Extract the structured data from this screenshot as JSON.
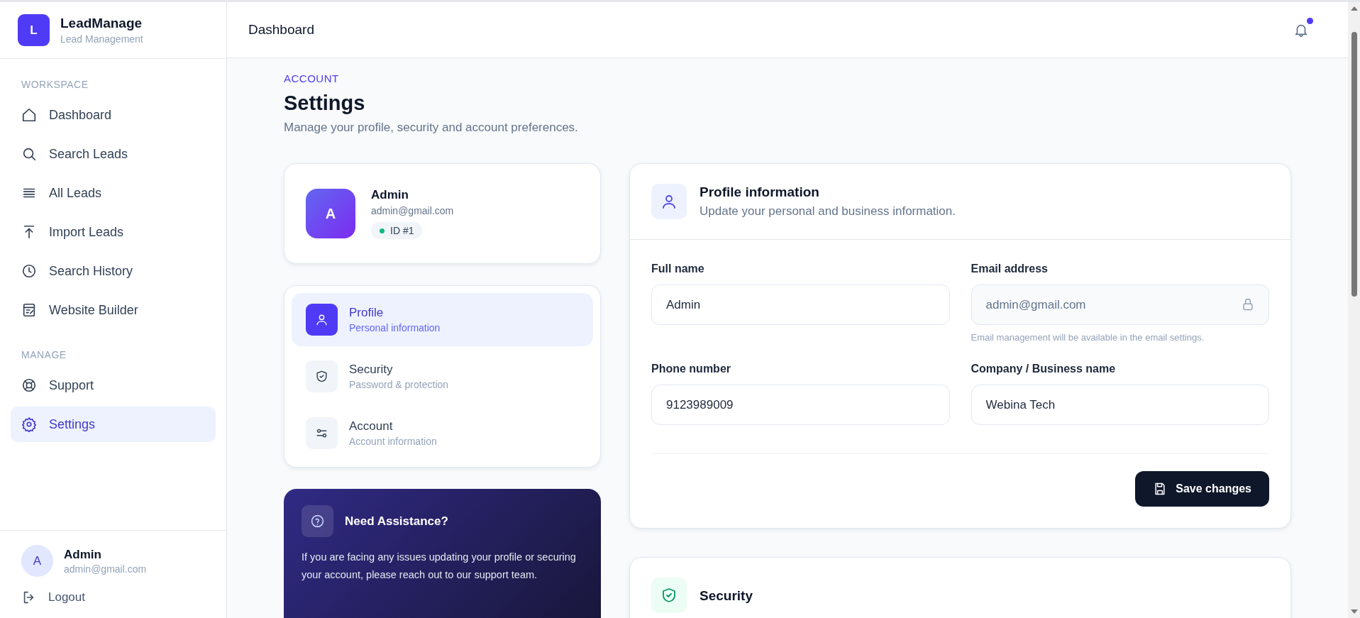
{
  "brand": {
    "logo_letter": "L",
    "name": "LeadManage",
    "tagline": "Lead Management"
  },
  "sidebar": {
    "sections": [
      {
        "title": "WORKSPACE",
        "items": [
          {
            "label": "Dashboard",
            "selected": false
          },
          {
            "label": "Search Leads",
            "selected": false
          },
          {
            "label": "All Leads",
            "selected": false
          },
          {
            "label": "Import Leads",
            "selected": false
          },
          {
            "label": "Search History",
            "selected": false
          },
          {
            "label": "Website Builder",
            "selected": false
          }
        ]
      },
      {
        "title": "MANAGE",
        "items": [
          {
            "label": "Support",
            "selected": false
          },
          {
            "label": "Settings",
            "selected": true
          }
        ]
      }
    ]
  },
  "user": {
    "avatar_letter": "A",
    "name": "Admin",
    "email": "admin@gmail.com"
  },
  "logout": "Logout",
  "header": {
    "title": "Dashboard",
    "notification_unread": true
  },
  "page": {
    "eyebrow": "ACCOUNT",
    "title": "Settings",
    "subtitle": "Manage your profile, security and account preferences."
  },
  "profile_card": {
    "avatar_letter": "A",
    "name": "Admin",
    "email": "admin@gmail.com",
    "id_badge": "ID #1"
  },
  "settings_nav": [
    {
      "label": "Profile",
      "sublabel": "Personal information",
      "selected": true
    },
    {
      "label": "Security",
      "sublabel": "Password & protection",
      "selected": false
    },
    {
      "label": "Account",
      "sublabel": "Account information",
      "selected": false
    }
  ],
  "assistance": {
    "title": "Need Assistance?",
    "text": "If you are facing any issues updating your profile or securing your account, please reach out to our support team."
  },
  "profile_form": {
    "title": "Profile information",
    "subtitle": "Update your personal and business information.",
    "fields": [
      {
        "label": "Full name",
        "value": "Admin",
        "locked": false
      },
      {
        "label": "Email address",
        "value": "admin@gmail.com",
        "locked": true,
        "hint": "Email management will be available in the email settings."
      },
      {
        "label": "Phone number",
        "value": "9123989009",
        "locked": false
      },
      {
        "label": "Company / Business name",
        "value": "Webina Tech",
        "locked": false
      }
    ],
    "save_button": "Save changes"
  },
  "security_section": {
    "title": "Security"
  }
}
